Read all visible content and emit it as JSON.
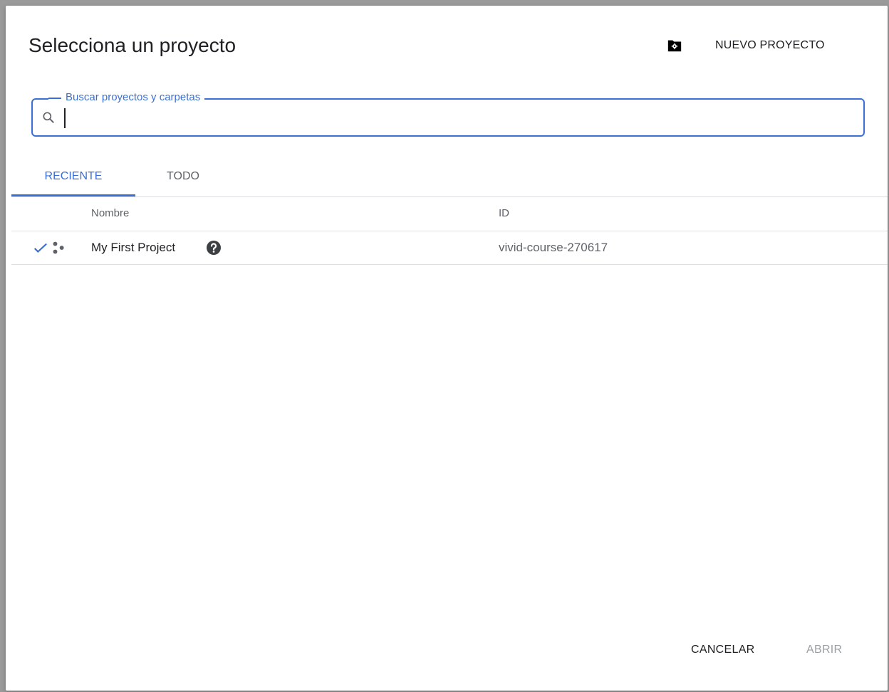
{
  "dialog": {
    "title": "Selecciona un proyecto",
    "new_project_label": "NUEVO PROYECTO"
  },
  "search": {
    "label": "Buscar proyectos y carpetas",
    "value": ""
  },
  "tabs": [
    {
      "label": "RECIENTE",
      "active": true
    },
    {
      "label": "TODO",
      "active": false
    }
  ],
  "table": {
    "columns": [
      "Nombre",
      "ID"
    ],
    "rows": [
      {
        "name": "My First Project",
        "id": "vivid-course-270617",
        "selected": true
      }
    ]
  },
  "footer": {
    "cancel_label": "CANCELAR",
    "open_label": "ABRIR"
  },
  "colors": {
    "accent": "#3b6fd4",
    "text": "#202124",
    "muted": "#5f6368",
    "disabled": "#9aa0a6"
  },
  "icons": {
    "new_project": "folder-settings-icon",
    "search": "search-icon",
    "selected": "check-icon",
    "project": "project-dots-icon",
    "help": "help-icon"
  }
}
